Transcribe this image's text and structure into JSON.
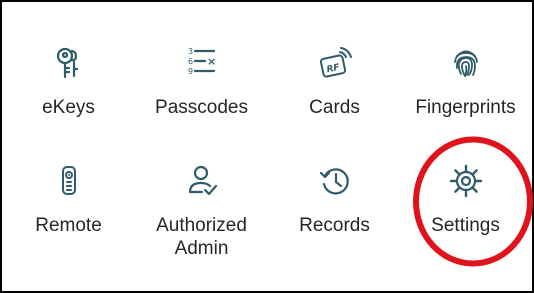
{
  "accent_color": "#2f5c6a",
  "annotation_color": "#e0121b",
  "tiles": [
    {
      "label": "eKeys",
      "icon": "key-icon"
    },
    {
      "label": "Passcodes",
      "icon": "passcode-icon"
    },
    {
      "label": "Cards",
      "icon": "rf-card-icon"
    },
    {
      "label": "Fingerprints",
      "icon": "fingerprint-icon"
    },
    {
      "label": "Remote",
      "icon": "remote-icon"
    },
    {
      "label": "Authorized\nAdmin",
      "icon": "admin-user-icon"
    },
    {
      "label": "Records",
      "icon": "history-icon"
    },
    {
      "label": "Settings",
      "icon": "gear-icon"
    }
  ],
  "icon_texts": {
    "passcode_lines": [
      "3",
      "6",
      "9"
    ],
    "passcode_mark": "×",
    "card_text": "RF"
  }
}
